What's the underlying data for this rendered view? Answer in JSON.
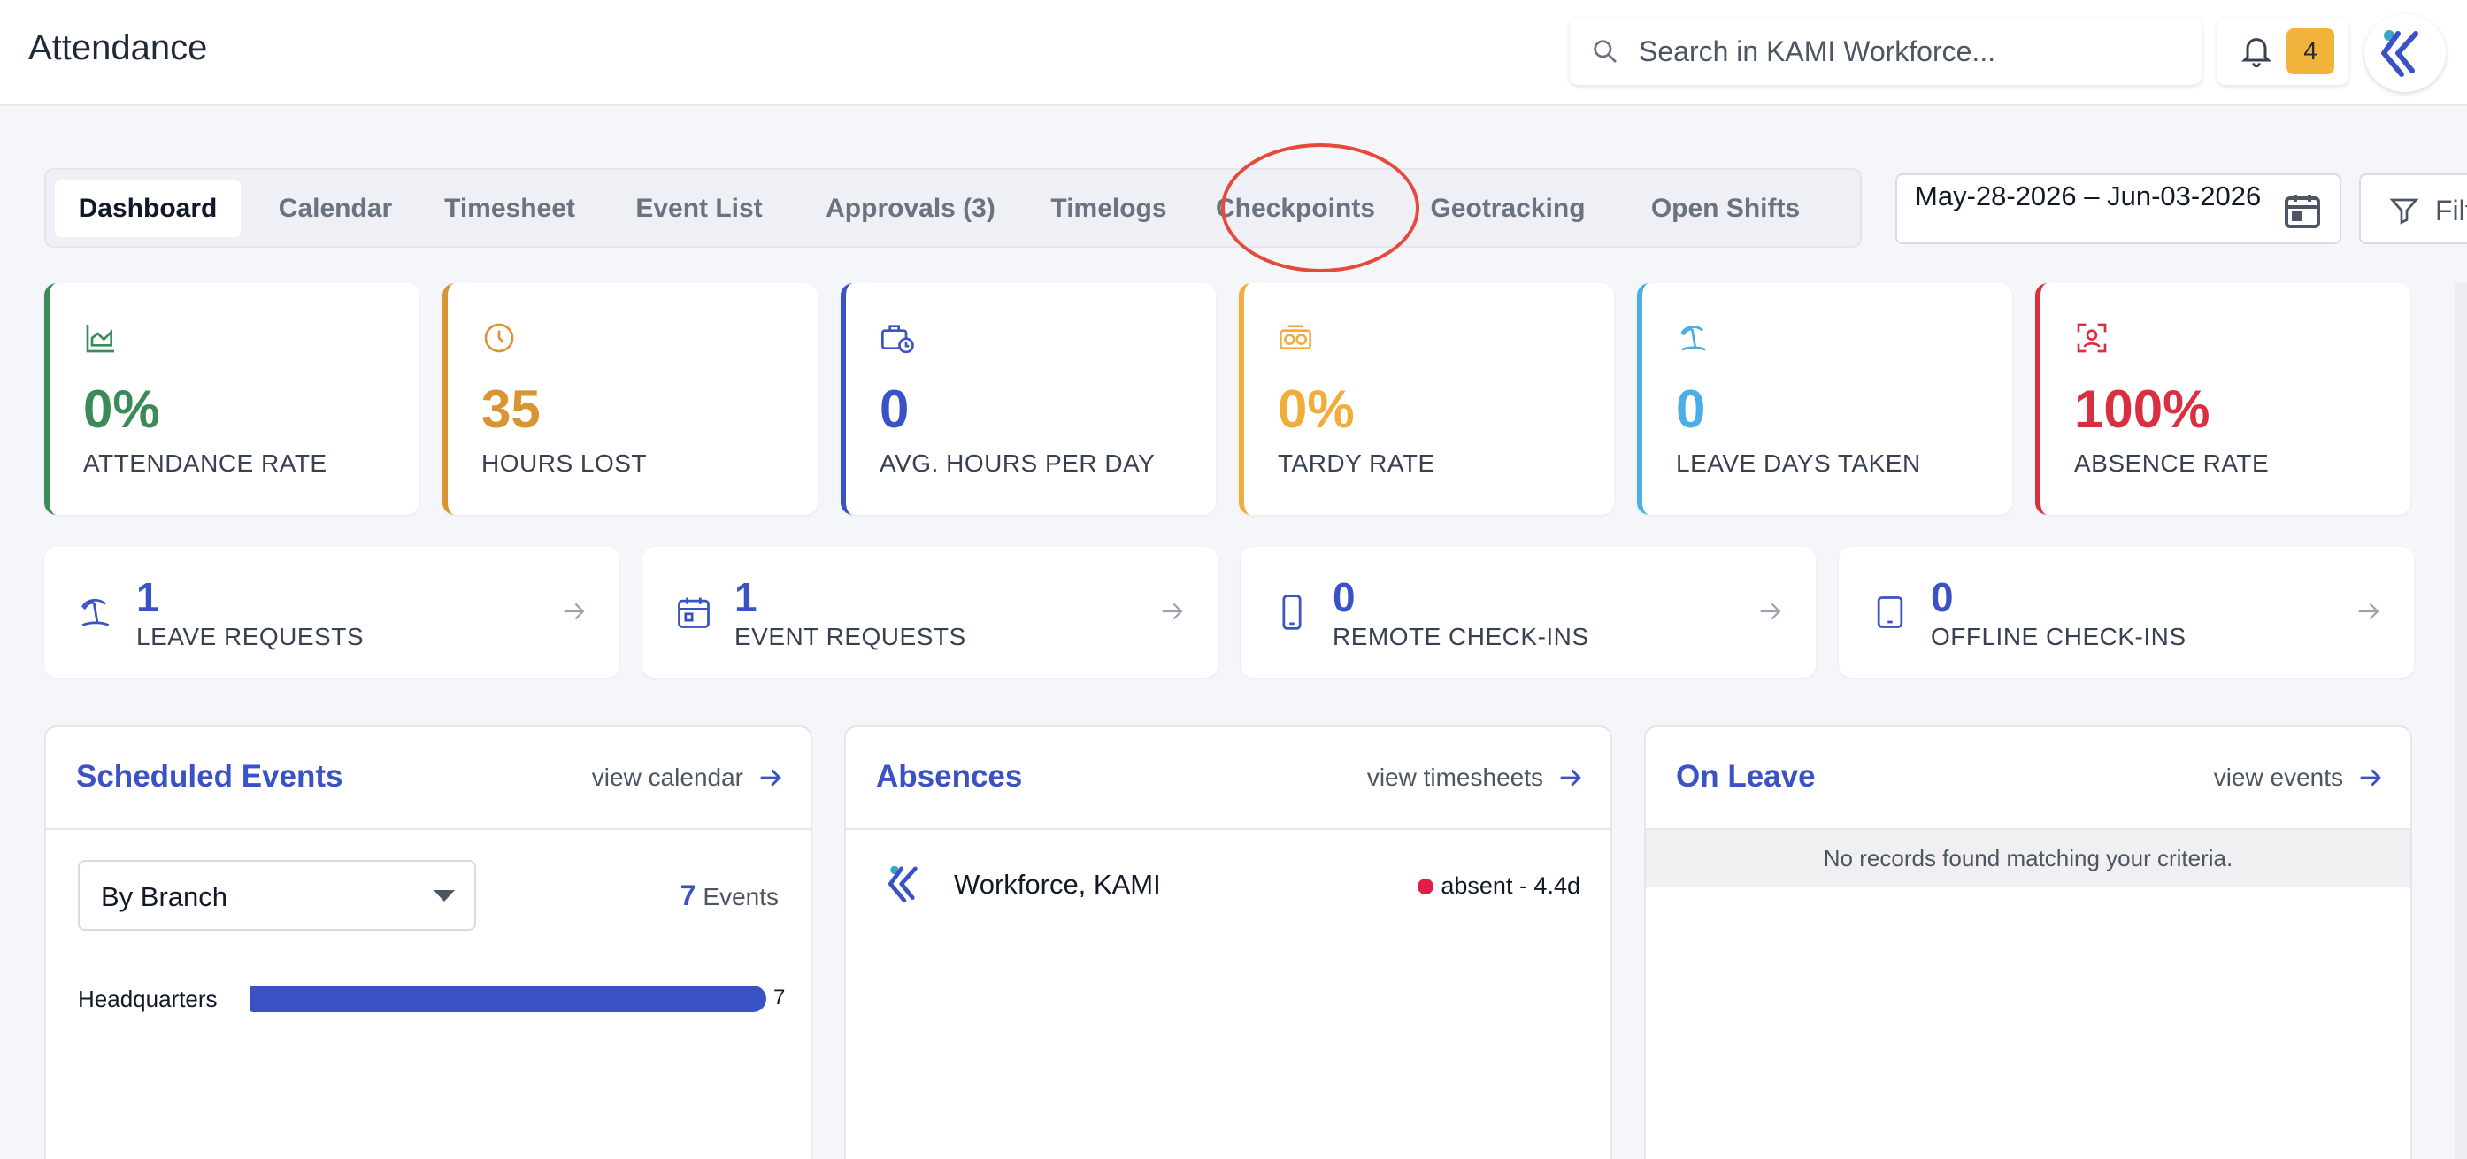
{
  "header": {
    "title": "Attendance",
    "search_placeholder": "Search in KAMI Workforce...",
    "notifications_count": "4"
  },
  "tabs": [
    {
      "label": "Dashboard",
      "active": true
    },
    {
      "label": "Calendar"
    },
    {
      "label": "Timesheet"
    },
    {
      "label": "Event List"
    },
    {
      "label": "Approvals (3)"
    },
    {
      "label": "Timelogs"
    },
    {
      "label": "Checkpoints"
    },
    {
      "label": "Geotracking"
    },
    {
      "label": "Open Shifts"
    }
  ],
  "date_range": "May-28-2026 – Jun-03-2026",
  "filter_label": "Filter",
  "stats": [
    {
      "value": "0%",
      "label": "ATTENDANCE RATE",
      "color": "#3a8a5a",
      "icon": "chart-area-icon"
    },
    {
      "value": "35",
      "label": "HOURS LOST",
      "color": "#d99433",
      "icon": "clock-icon"
    },
    {
      "value": "0",
      "label": "AVG. HOURS PER DAY",
      "color": "#3b52c4",
      "icon": "briefcase-clock-icon"
    },
    {
      "value": "0%",
      "label": "TARDY RATE",
      "color": "#f0ad3a",
      "icon": "timer-icon"
    },
    {
      "value": "0",
      "label": "LEAVE DAYS TAKEN",
      "color": "#4aaee8",
      "icon": "beach-icon"
    },
    {
      "value": "100%",
      "label": "ABSENCE RATE",
      "color": "#d9303f",
      "icon": "absence-icon"
    }
  ],
  "requests": [
    {
      "value": "1",
      "label": "LEAVE REQUESTS",
      "icon": "beach-icon"
    },
    {
      "value": "1",
      "label": "EVENT REQUESTS",
      "icon": "calendar-icon"
    },
    {
      "value": "0",
      "label": "REMOTE CHECK-INS",
      "icon": "phone-icon"
    },
    {
      "value": "0",
      "label": "OFFLINE CHECK-INS",
      "icon": "tablet-icon"
    }
  ],
  "scheduled_events": {
    "title": "Scheduled Events",
    "link": "view calendar",
    "select_value": "By Branch",
    "count": "7",
    "count_label": "Events",
    "bars": [
      {
        "label": "Headquarters",
        "value": 7,
        "max": 7
      }
    ]
  },
  "absences": {
    "title": "Absences",
    "link": "view timesheets",
    "rows": [
      {
        "name": "Workforce, KAMI",
        "status": "absent - 4.4d"
      }
    ]
  },
  "on_leave": {
    "title": "On Leave",
    "link": "view events",
    "empty": "No records found matching your criteria."
  }
}
